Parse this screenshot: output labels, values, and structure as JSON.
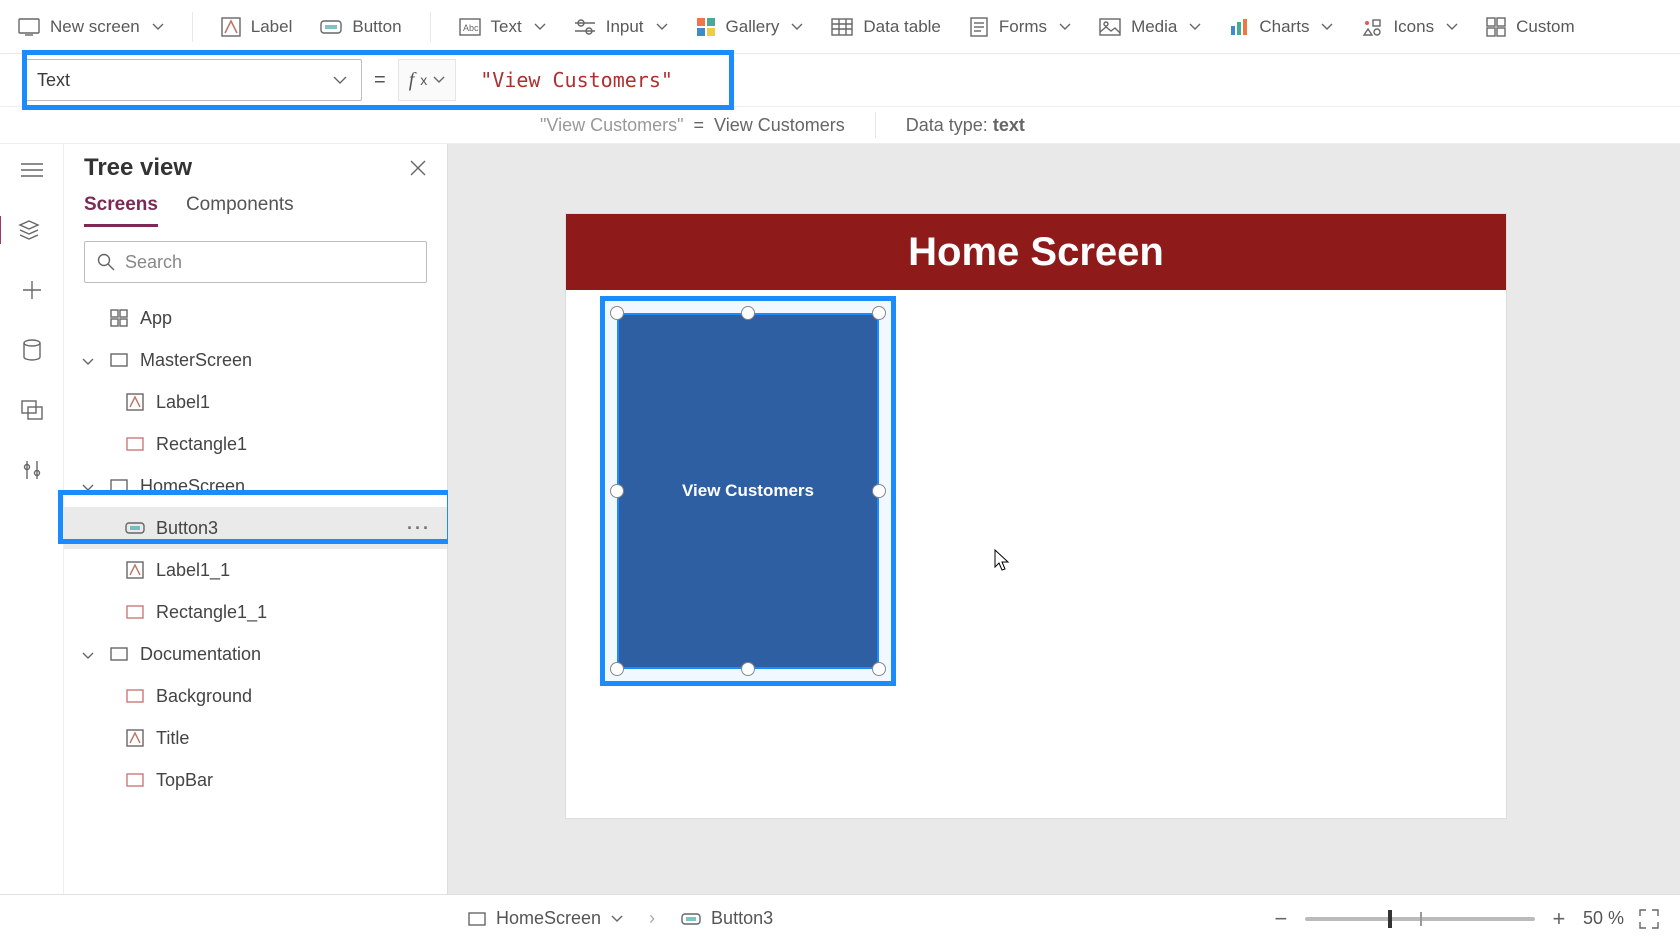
{
  "toolbar": {
    "new_screen": "New screen",
    "label": "Label",
    "button": "Button",
    "text": "Text",
    "input": "Input",
    "gallery": "Gallery",
    "data_table": "Data table",
    "forms": "Forms",
    "media": "Media",
    "charts": "Charts",
    "icons": "Icons",
    "custom": "Custom"
  },
  "formula": {
    "property": "Text",
    "value": "\"View Customers\""
  },
  "info": {
    "expr": "\"View Customers\"",
    "equals": "=",
    "result": "View Customers",
    "datatype_label": "Data type:",
    "datatype": "text"
  },
  "tree": {
    "title": "Tree view",
    "tab_screens": "Screens",
    "tab_components": "Components",
    "search_placeholder": "Search",
    "items": {
      "app": "App",
      "master": "MasterScreen",
      "label1": "Label1",
      "rect1": "Rectangle1",
      "home": "HomeScreen",
      "button3": "Button3",
      "label11": "Label1_1",
      "rect11": "Rectangle1_1",
      "doc": "Documentation",
      "background": "Background",
      "title": "Title",
      "topbar": "TopBar"
    }
  },
  "canvas": {
    "header": "Home Screen",
    "button_text": "View Customers"
  },
  "breadcrumb": {
    "screen": "HomeScreen",
    "element": "Button3"
  },
  "zoom": {
    "value": "50",
    "unit": "%"
  }
}
